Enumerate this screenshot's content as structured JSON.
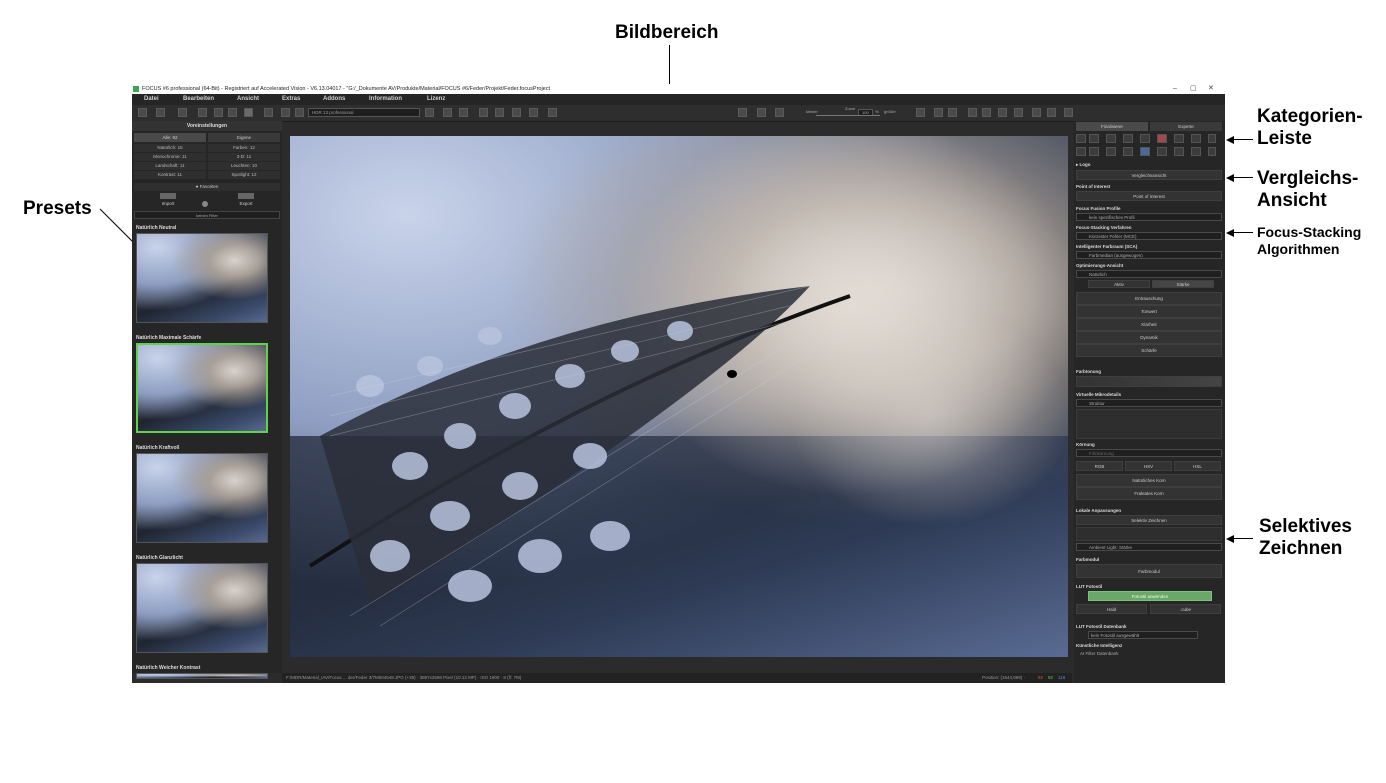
{
  "annotations": {
    "bildbereich": "Bildbereich",
    "presets": "Presets",
    "kategorien_1": "Kategorien-",
    "kategorien_2": "Leiste",
    "vergleich_1": "Vergleichs-",
    "vergleich_2": "Ansicht",
    "focus_1": "Focus-Stacking",
    "focus_2": "Algorithmen",
    "selektiv_1": "Selektives",
    "selektiv_2": "Zeichnen"
  },
  "window": {
    "title": "FOCUS #6 professional (64-Bit) - Registriert auf Accelerated Vision - V6.13.04017 - \"G:/_Dokumente AV/Produkte/Material/FOCUS #6/Feder/Projekt/Feder.focusProject",
    "controls": [
      "–",
      "▢",
      "✕"
    ]
  },
  "menu": [
    "Datei",
    "Bearbeiten",
    "Ansicht",
    "Extras",
    "Addons",
    "Information",
    "Lizenz"
  ],
  "toolbar": {
    "preset_select": "HDR 13 professional",
    "zoom_label_left": "kleiner",
    "zoom_label": "Zoom",
    "zoom_value": "100",
    "zoom_unit": "%",
    "zoom_label_right": "größer"
  },
  "left_panel": {
    "header": "Voreinstellungen",
    "tabs": [
      "Alle: 92",
      "Eigene"
    ],
    "stats": [
      "Natürlich: 15",
      "Farben: 12",
      "Monochrome: 11",
      "3-D: 11",
      "Landschaft: 11",
      "Leuchten: 10",
      "Kontrast: 11",
      "Spotlight: 12"
    ],
    "favorites": "● Favoriten",
    "import": "Import",
    "export": "Export",
    "filter": "keinen Filter",
    "presets": [
      "Natürlich Neutral",
      "Natürlich Maximale Schärfe",
      "Natürlich Kraftvoll",
      "Natürlich Glanzlicht",
      "Natürlich Weicher Kontrast"
    ]
  },
  "statusbar": {
    "path": "F:/MDR/Material_IAV/Focus ... der/Feder 3/7M004548.JPG (+39) · 3897x2598 Pixel (10.12 MP) · ISO 1600 · 8 (f/: 7M)",
    "position": "Position: (1644,969) ·",
    "r": "92",
    "g": "92",
    "b": "118"
  },
  "right_panel": {
    "tabs": [
      "Finalisierer",
      "Experte"
    ],
    "logo": "▸ Logo",
    "compare": "Vergleichsansicht",
    "poi_h": "Point of Interest",
    "poi_btn": "Point of Interest",
    "profile_h": "Focus Fusion Profile",
    "profile_val": "kein spezifisches Profil",
    "stacking_h": "Focus-Stacking Verfahren",
    "stacking_val": "Kürzester Fehler (MCE)",
    "farbraum_h": "Intelligenter Farbraum (SCA)",
    "farbraum_val": "Farbmedian (ausgewogen)",
    "opt_h": "Optimierungs-Ansicht",
    "opt_val": "Natürlich",
    "opt_tabs": [
      "Aktiv",
      "Stärke"
    ],
    "opt_items": [
      "Entrauschung",
      "Tonwert",
      "Klarheit",
      "Dynamik",
      "Schärfe"
    ],
    "farb_h": "Farbtonung",
    "mikro_h": "Virtuelle Mikrodetails",
    "mikro_val": "Struktur",
    "koern_h": "Körnung",
    "koern_val": "Filmkörnung",
    "koern_modes": [
      "RGB",
      "HSV",
      "HSL"
    ],
    "koern_items": [
      "Natürliches Korn",
      "Fraktales Korn"
    ],
    "lokal_h": "Lokale Anpassungen",
    "lokal_btn": "Selektiv Zeichnen",
    "lokal_val": "Ambient Light: Stärke",
    "farbmodul_h": "Farbmodul",
    "farbmodul_btn": "Farbmodul",
    "lut_h": "LUT Fotostil",
    "lut_green": "Fotostil anwenden",
    "lut_btns": [
      "Hald",
      ".cube"
    ],
    "lutdb_h": "LUT Fotostil Datenbank",
    "lutdb_val": "kein Fotostil ausgewählt",
    "ki_h": "Künstliche Intelligenz",
    "ki_sub": "AI Filter Datenbank"
  }
}
